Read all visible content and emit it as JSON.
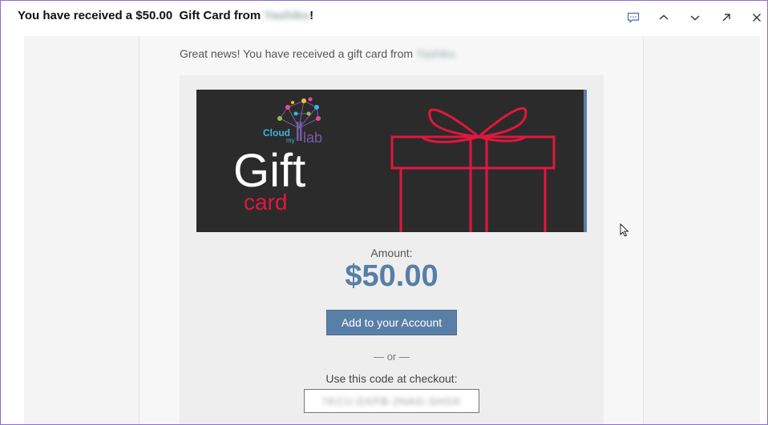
{
  "header": {
    "subject_prefix": "You have received a $50.00  Gift Card from ",
    "subject_sender": "Yashiku",
    "subject_suffix": "!",
    "buttons": [
      "chat-icon",
      "chevron-up-icon",
      "chevron-down-icon",
      "popout-icon",
      "close-icon"
    ]
  },
  "message": {
    "greeting_prefix": "Great news! You have received a gift card from ",
    "greeting_sender": "Yashiku",
    "banner": {
      "logo_line1": "Cloud",
      "logo_line2": "my",
      "logo_lab": "lab",
      "gift_word": "Gift",
      "card_word": "card"
    },
    "amount_label": "Amount:",
    "amount_value": "$50.00",
    "add_button_label": "Add to your Account",
    "or_separator": "— or —",
    "code_label": "Use this code at checkout:",
    "code_value": "7KCU-DXPB-2NAG-SHGK"
  },
  "colors": {
    "accent": "#577fa6",
    "banner_bg": "#2c2b2b",
    "gift_red": "#e0173f"
  }
}
